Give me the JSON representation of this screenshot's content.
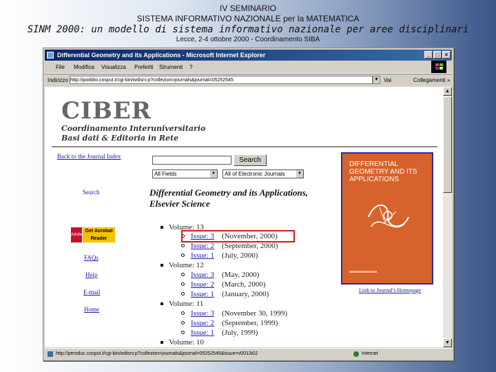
{
  "slide": {
    "line1": "IV SEMINARIO",
    "line2": "SISTEMA INFORMATIVO NAZIONALE per la MATEMATICA",
    "line3": "SINM 2000: un modello di sistema informativo nazionale per aree disciplinari",
    "line4": "Lecce, 2-4 ottobre 2000 - Coordinamento SIBA"
  },
  "window": {
    "title": "Differential Geometry and its Applications - Microsoft Internet Explorer",
    "controls": {
      "minimize": "_",
      "maximize": "□",
      "close": "×"
    }
  },
  "menu": {
    "items": [
      "File",
      "Modifica",
      "Visualizza",
      "Preferiti",
      "Strumenti",
      "?"
    ]
  },
  "address": {
    "label": "Indirizzo",
    "url": "http://poiddio.cosput.t/cgi-bin/wdisrv.p?collezion=journals&journal=05252545",
    "go": "Vai",
    "links": "Collegamenti »"
  },
  "site": {
    "logo": "CIBER",
    "sub1": "Coordinamento Interuniversitario",
    "sub2": "Basi dati & Editoria in Rete"
  },
  "nav": {
    "back": "Back to the Journal Index",
    "search": "Search",
    "acrobat_vendor": "Adobe",
    "acrobat_label": "Get Acrobat Reader",
    "faqs": "FAQs",
    "help": "Help",
    "email": "E-mail",
    "home": "Home"
  },
  "search": {
    "button": "Search",
    "field_select": "All Fields",
    "journal_select": "All of Electronic Journals"
  },
  "journal": {
    "title": "Differential Geometry and its Applications,",
    "publisher": "Elsevier Science"
  },
  "toc": {
    "volumes": [
      {
        "label": "Volume: 13",
        "issues": [
          {
            "link": "Issue: 3",
            "date": "(November, 2000)"
          }
        ]
      },
      {
        "label": "Volume: 12",
        "issues": [
          {
            "link": "Issue: 3",
            "date": "(May, 2000)"
          },
          {
            "link": "Issue: 2",
            "date": "(March, 2000)"
          },
          {
            "link": "Issue: 1",
            "date": "(January, 2000)"
          }
        ]
      },
      {
        "label": "Volume: 11",
        "issues": [
          {
            "link": "Issue: 3",
            "date": "(November 30, 1999)"
          },
          {
            "link": "Issue: 2",
            "date": "(September, 1999)"
          },
          {
            "link": "Issue: 1",
            "date": "(July, 1999)"
          }
        ]
      },
      {
        "label": "Volume: 10",
        "issues": []
      }
    ],
    "vol13_extra": [
      {
        "link": "Issue: 2",
        "date": "(September, 2000)"
      },
      {
        "link": "Issue: 1",
        "date": "(July, 2000)"
      }
    ]
  },
  "cover": {
    "title": "DIFFERENTIAL GEOMETRY AND ITS APPLICATIONS",
    "link": "Link to Journal's Homepage"
  },
  "status": {
    "url": "http://peroduc.cosput.t/cgi-bin/wdisrv.p?collezion=journals&journal=05252545&issue=v0013i02",
    "zone": "Internet"
  }
}
